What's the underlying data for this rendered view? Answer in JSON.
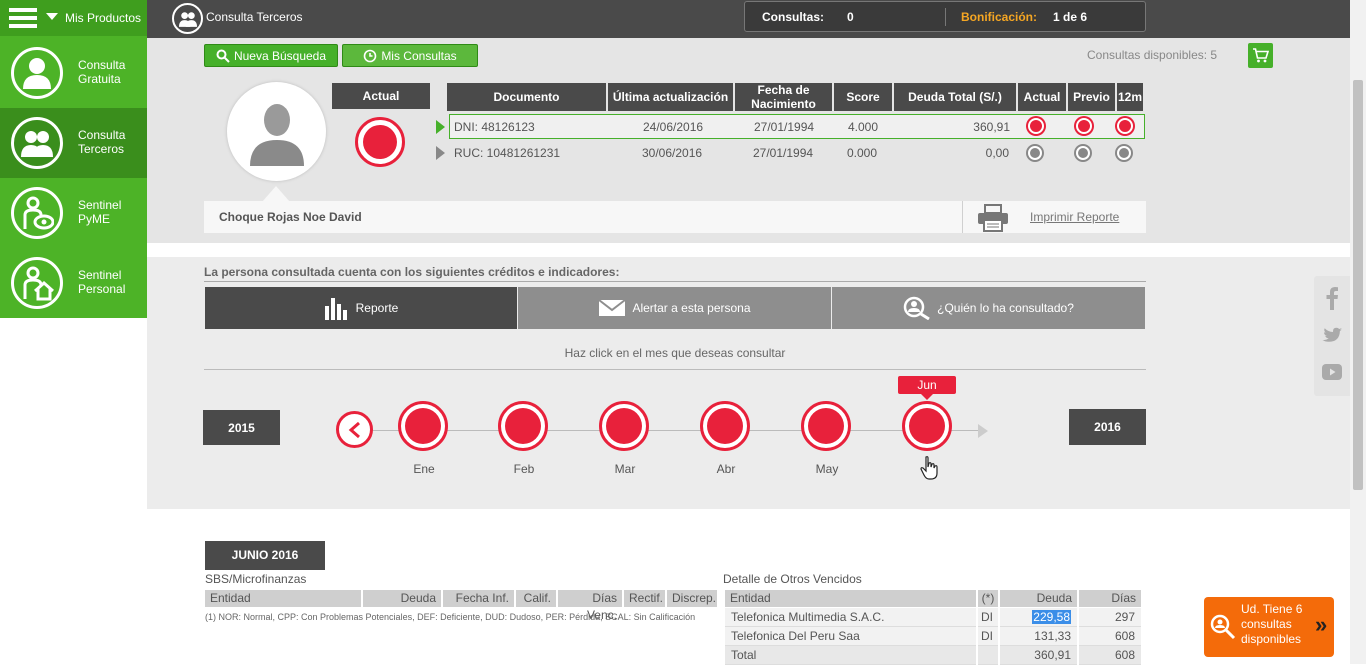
{
  "sidebar": {
    "menu_label": "Mis Productos",
    "items": [
      {
        "line1": "Consulta",
        "line2": "Gratuita"
      },
      {
        "line1": "Consulta",
        "line2": "Terceros"
      },
      {
        "line1": "Sentinel",
        "line2": "PyME"
      },
      {
        "line1": "Sentinel",
        "line2": "Personal"
      }
    ]
  },
  "topbar": {
    "title": "Consulta Terceros",
    "consultas_label": "Consultas:",
    "consultas_value": "0",
    "bonificacion_label": "Bonificación:",
    "bonificacion_value": "1 de 6"
  },
  "actions": {
    "nueva_busqueda": "Nueva Búsqueda",
    "mis_consultas": "Mis Consultas",
    "disponibles": "Consultas disponibles: 5"
  },
  "person": {
    "name": "Choque Rojas Noe David",
    "actual_label": "Actual",
    "print_label": "Imprimir Reporte"
  },
  "doc_table": {
    "headers": [
      "Documento",
      "Última actualización",
      "Fecha de Nacimiento",
      "Score",
      "Deuda Total (S/.)",
      "Actual",
      "Previo",
      "12m"
    ],
    "rows": [
      {
        "documento": "DNI: 48126123",
        "actualizacion": "24/06/2016",
        "nacimiento": "27/01/1994",
        "score": "4.000",
        "deuda": "360,91"
      },
      {
        "documento": "RUC: 10481261231",
        "actualizacion": "30/06/2016",
        "nacimiento": "27/01/1994",
        "score": "0.000",
        "deuda": "0,00"
      }
    ]
  },
  "creditos": {
    "intro": "La persona consultada cuenta con los siguientes créditos e indicadores:",
    "tabs": [
      "Reporte",
      "Alertar a esta persona",
      "¿Quién lo ha consultado?"
    ],
    "hint": "Haz click en el mes que deseas consultar"
  },
  "timeline": {
    "year_left": "2015",
    "year_right": "2016",
    "months": [
      "Ene",
      "Feb",
      "Mar",
      "Abr",
      "May",
      "Jun"
    ],
    "selected_tooltip": "Jun"
  },
  "report": {
    "period": "JUNIO 2016",
    "sbs_title": "SBS/Microfinanzas",
    "sbs_headers": [
      "Entidad",
      "Deuda",
      "Fecha Inf.",
      "Calif.",
      "Días Venc.",
      "Rectif.",
      "Discrep."
    ],
    "sbs_note": "(1) NOR: Normal, CPP: Con Problemas Potenciales, DEF: Deficiente, DUD: Dudoso, PER: Pérdida, SCAL: Sin Calificación",
    "otros_title": "Detalle de Otros Vencidos",
    "otros_headers": [
      "Entidad",
      "(*)",
      "Deuda",
      "Días Venc."
    ],
    "otros_rows": [
      {
        "entidad": "Telefonica Multimedia S.A.C.",
        "tipo": "DI",
        "deuda": "229,58",
        "dias": "297"
      },
      {
        "entidad": "Telefonica Del Peru Saa",
        "tipo": "DI",
        "deuda": "131,33",
        "dias": "608"
      },
      {
        "entidad": "Total",
        "tipo": "",
        "deuda": "360,91",
        "dias": "608"
      }
    ]
  },
  "promo": {
    "text": "Ud. Tiene 6 consultas disponibles"
  },
  "social": [
    "facebook-icon",
    "twitter-icon",
    "youtube-icon"
  ]
}
